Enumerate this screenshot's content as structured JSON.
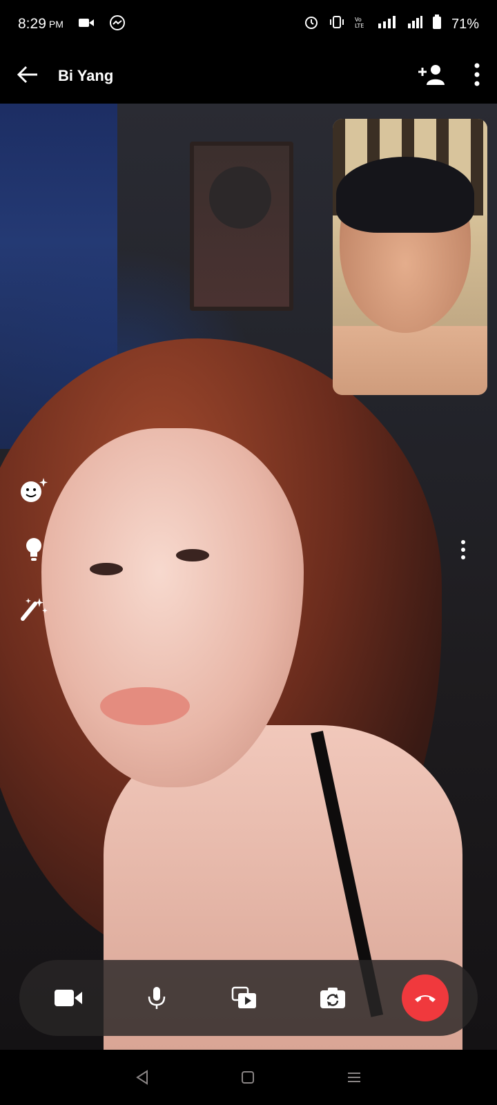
{
  "status_bar": {
    "time": "8:29",
    "ampm": "PM",
    "battery": "71%",
    "left_icons": [
      "video-icon",
      "messenger-icon"
    ],
    "right_icons": [
      "alarm-icon",
      "vibrate-icon",
      "volte-icon",
      "lte-signal-icon",
      "signal-icon",
      "battery-icon"
    ]
  },
  "app_bar": {
    "back_icon": "arrow-left-icon",
    "title": "Bi Yang",
    "add_person_icon": "add-person-icon",
    "more_icon": "more-vertical-icon"
  },
  "side_tools": [
    "emoji-effects-icon",
    "lighting-icon",
    "magic-wand-icon"
  ],
  "call_controls": [
    "video-camera-icon",
    "microphone-icon",
    "share-screen-icon",
    "flip-camera-icon",
    "end-call-icon"
  ],
  "colors": {
    "end_call": "#f0393d",
    "controls_bg": "#282626"
  },
  "nav_bar": [
    "back-triangle-icon",
    "home-square-icon",
    "recents-menu-icon"
  ]
}
